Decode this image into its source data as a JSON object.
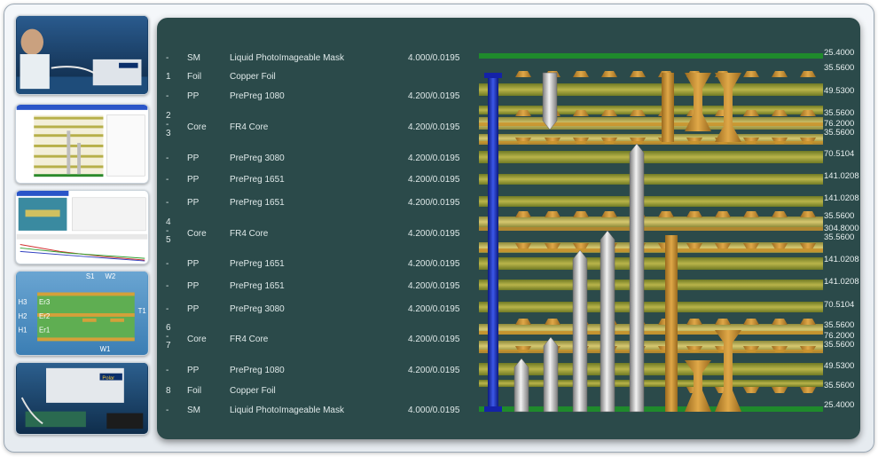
{
  "stackup": {
    "rows": [
      {
        "num": "-",
        "type": "SM",
        "material": "Liquid PhotoImageable Mask",
        "spec": "4.000/0.0195",
        "values": [
          "25.4000"
        ]
      },
      {
        "num": "1",
        "type": "Foil",
        "material": "Copper Foil",
        "spec": "",
        "values": [
          "35.5600"
        ]
      },
      {
        "num": "-",
        "type": "PP",
        "material": "PrePreg 1080",
        "spec": "4.200/0.0195",
        "values": [
          "49.5300"
        ]
      },
      {
        "num": "2\n-\n3",
        "type": "Core",
        "material": "FR4 Core",
        "spec": "4.200/0.0195",
        "values": [
          "35.5600",
          "76.2000",
          "35.5600"
        ]
      },
      {
        "num": "-",
        "type": "PP",
        "material": "PrePreg 3080",
        "spec": "4.200/0.0195",
        "values": [
          "70.5104"
        ]
      },
      {
        "num": "-",
        "type": "PP",
        "material": "PrePreg 1651",
        "spec": "4.200/0.0195",
        "values": [
          "141.0208"
        ]
      },
      {
        "num": "-",
        "type": "PP",
        "material": "PrePreg 1651",
        "spec": "4.200/0.0195",
        "values": [
          "141.0208"
        ]
      },
      {
        "num": "4\n-\n5",
        "type": "Core",
        "material": "FR4 Core",
        "spec": "4.200/0.0195",
        "values": [
          "35.5600",
          "304.8000",
          "35.5600"
        ]
      },
      {
        "num": "-",
        "type": "PP",
        "material": "PrePreg 1651",
        "spec": "4.200/0.0195",
        "values": [
          "141.0208"
        ]
      },
      {
        "num": "-",
        "type": "PP",
        "material": "PrePreg 1651",
        "spec": "4.200/0.0195",
        "values": [
          "141.0208"
        ]
      },
      {
        "num": "-",
        "type": "PP",
        "material": "PrePreg 3080",
        "spec": "4.200/0.0195",
        "values": [
          "70.5104"
        ]
      },
      {
        "num": "6\n-\n7",
        "type": "Core",
        "material": "FR4 Core",
        "spec": "4.200/0.0195",
        "values": [
          "35.5600",
          "76.2000",
          "35.5600"
        ]
      },
      {
        "num": "-",
        "type": "PP",
        "material": "PrePreg 1080",
        "spec": "4.200/0.0195",
        "values": [
          "49.5300"
        ]
      },
      {
        "num": "8",
        "type": "Foil",
        "material": "Copper Foil",
        "spec": "",
        "values": [
          "35.5600"
        ]
      },
      {
        "num": "-",
        "type": "SM",
        "material": "Liquid PhotoImageable Mask",
        "spec": "4.000/0.0195",
        "values": [
          "25.4000"
        ]
      }
    ]
  },
  "thumbnails": {
    "diagram": {
      "labels": [
        "S1",
        "W2",
        "H3",
        "Er3",
        "H2",
        "Er2",
        "H1",
        "Er1",
        "T1",
        "W1"
      ]
    },
    "device_brand": "Polar"
  },
  "colors": {
    "panel_bg": "#2b4a4a",
    "solder_mask": "#1f8a2c",
    "copper": "#c8922c",
    "prepreg": "#a7a23a",
    "core": "#c2b15c",
    "via_blue": "#1a2fb8",
    "via_silver": "#c8c8c8"
  }
}
